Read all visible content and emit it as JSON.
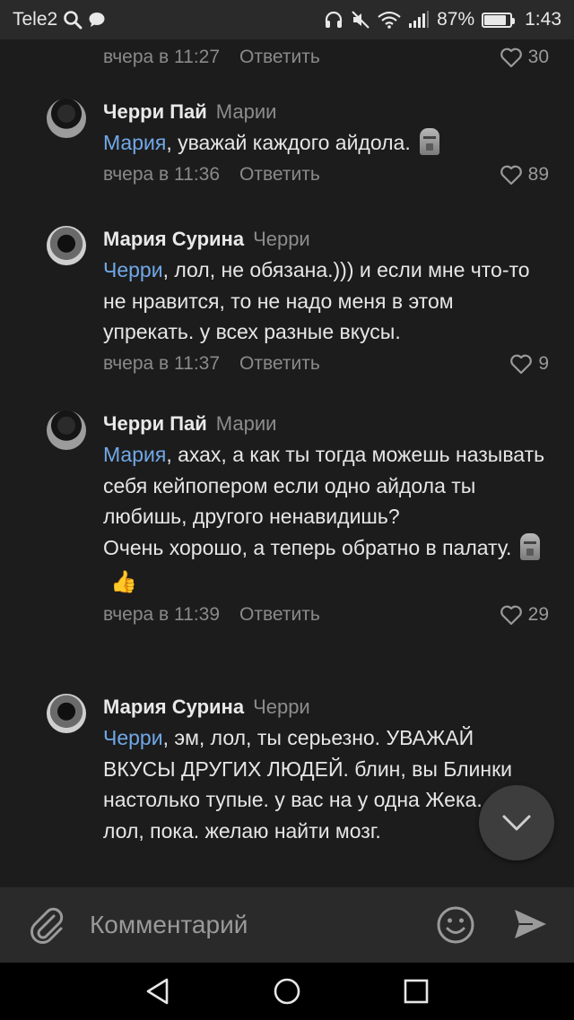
{
  "status_bar": {
    "carrier": "Tele2",
    "battery": "87%",
    "battery_level": 0.87,
    "time": "1:43",
    "icons": [
      "search-icon",
      "chat-bubble-icon",
      "headphones-icon",
      "mute-icon",
      "wifi-icon",
      "signal-icon",
      "battery-icon"
    ]
  },
  "comments": [
    {
      "author": "",
      "reply_to": "",
      "mention": "",
      "text": "",
      "time": "вчера в 11:27",
      "reply_label": "Ответить",
      "likes": "30"
    },
    {
      "author": "Черри Пай",
      "reply_to": "Марии",
      "mention": "Мария",
      "text": ", уважай каждого айдола.",
      "time": "вчера в 11:36",
      "reply_label": "Ответить",
      "likes": "89"
    },
    {
      "author": "Мария Сурина",
      "reply_to": "Черри",
      "mention": "Черри",
      "text": ", лол, не обязана.))) и если мне что-то не нравится, то не надо меня в этом упрекать. у всех разные вкусы.",
      "time": "вчера в 11:37",
      "reply_label": "Ответить",
      "likes": "9"
    },
    {
      "author": "Черри Пай",
      "reply_to": "Марии",
      "mention": "Мария",
      "text": ", ахах, а как ты тогда можешь называть себя кейпопером если одно айдола ты любишь, другого ненавидишь?",
      "text2": "Очень хорошо, а теперь обратно в палату.",
      "time": "вчера в 11:39",
      "reply_label": "Ответить",
      "likes": "29"
    },
    {
      "author": "Мария Сурина",
      "reply_to": "Черри",
      "mention": "Черри",
      "text": ", эм, лол, ты серьезно. УВАЖАЙ ВКУСЫ ДРУГИХ ЛЮДЕЙ. блин, вы Блинки настолько тупые. у вас на у одна Жека.",
      "text2": "лол, пока. желаю найти мозг."
    }
  ],
  "composer": {
    "placeholder": "Комментарий"
  },
  "colors": {
    "background": "#1c1c1c",
    "bar": "#2a2a2a",
    "mention": "#71a8e8",
    "meta": "#8a8a8a"
  }
}
